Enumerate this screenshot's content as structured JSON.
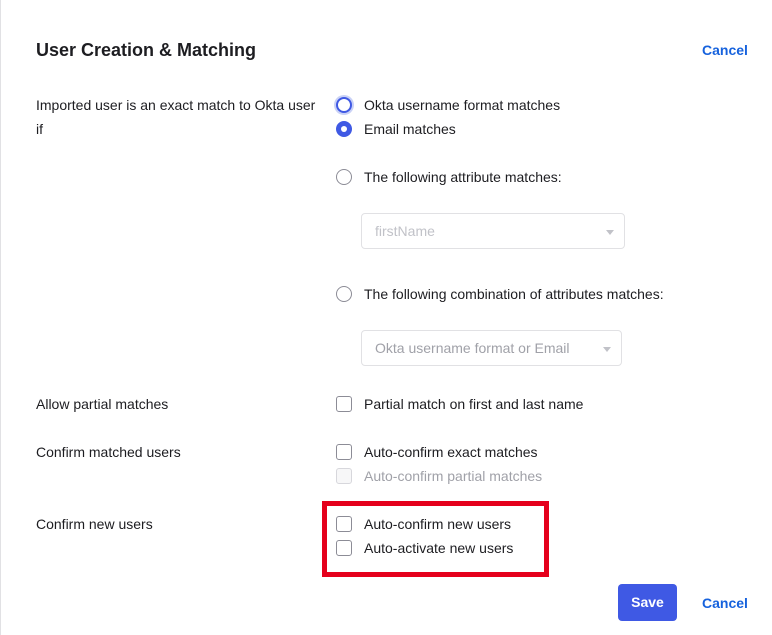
{
  "header": {
    "title": "User Creation & Matching",
    "cancel_label": "Cancel"
  },
  "exact_match": {
    "label": "Imported user is an exact match to Okta user if",
    "options": [
      {
        "label": "Okta username format matches",
        "selected": false
      },
      {
        "label": "Email matches",
        "selected": true
      },
      {
        "label": "The following attribute matches:",
        "selected": false
      },
      {
        "label": "The following combination of attributes matches:",
        "selected": false
      }
    ],
    "attribute_select": {
      "value": "firstName",
      "disabled": true
    },
    "combination_select": {
      "value": "Okta username format or Email"
    }
  },
  "partial": {
    "label": "Allow partial matches",
    "option": "Partial match on first and last name"
  },
  "confirm_matched": {
    "label": "Confirm matched users",
    "options": [
      {
        "label": "Auto-confirm exact matches",
        "disabled": false
      },
      {
        "label": "Auto-confirm partial matches",
        "disabled": true
      }
    ]
  },
  "confirm_new": {
    "label": "Confirm new users",
    "options": [
      {
        "label": "Auto-confirm new users"
      },
      {
        "label": "Auto-activate new users"
      }
    ]
  },
  "footer": {
    "save_label": "Save",
    "cancel_label": "Cancel"
  },
  "colors": {
    "accent": "#3f59e4",
    "link": "#1662dd",
    "highlight": "#e5001c"
  }
}
